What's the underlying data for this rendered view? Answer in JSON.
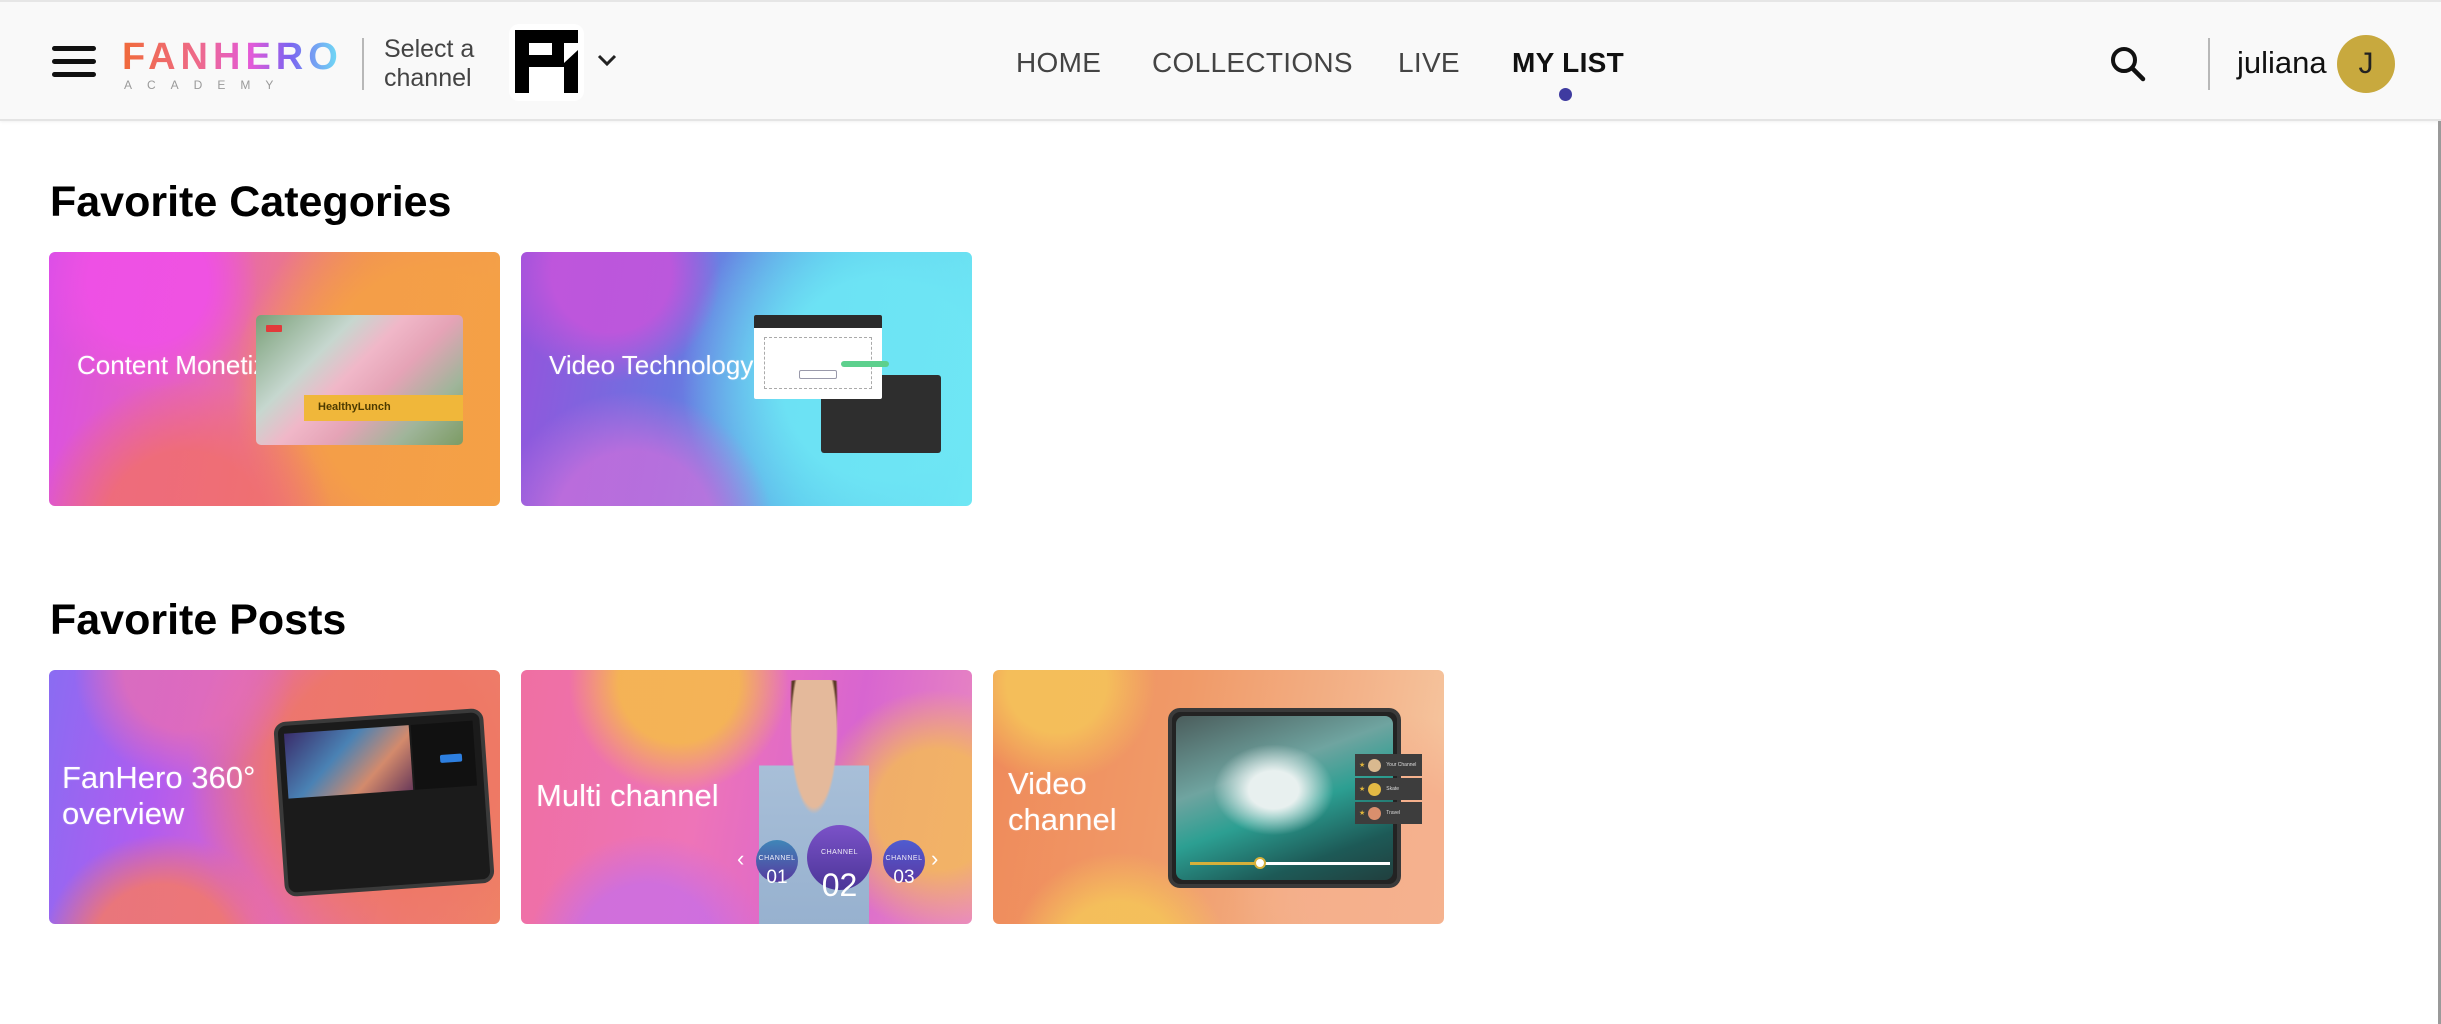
{
  "header": {
    "logo": {
      "main": "FANHERO",
      "sub": "ACADEMY"
    },
    "channel_select_label": "Select a channel",
    "selected_channel": "FH",
    "nav": [
      {
        "label": "HOME",
        "active": false
      },
      {
        "label": "COLLECTIONS",
        "active": false
      },
      {
        "label": "LIVE",
        "active": false
      },
      {
        "label": "MY LIST",
        "active": true
      }
    ],
    "active_indicator_color": "#3f3ba0",
    "user": {
      "name": "juliana",
      "initial": "J",
      "avatar_color": "#c8a93e"
    },
    "icons": {
      "menu": "hamburger-icon",
      "search": "search-icon",
      "dropdown": "chevron-down-icon"
    }
  },
  "sections": {
    "categories": {
      "title": "Favorite Categories",
      "items": [
        {
          "label": "Content Monetization",
          "thumb_text": "HealthyLunch"
        },
        {
          "label": "Video Technology"
        }
      ]
    },
    "posts": {
      "title": "Favorite Posts",
      "items": [
        {
          "label": "FanHero 360° overview"
        },
        {
          "label": "Multi channel",
          "channels": [
            {
              "caption": "CHANNEL",
              "number": "01"
            },
            {
              "caption": "CHANNEL",
              "number": "02"
            },
            {
              "caption": "CHANNEL",
              "number": "03"
            }
          ],
          "arrows": {
            "prev": "‹",
            "next": "›"
          }
        },
        {
          "label": "Video channel",
          "channel_list": [
            "Your Channel",
            "Skate",
            "Travel"
          ],
          "video_progress": 0.35
        }
      ]
    }
  }
}
